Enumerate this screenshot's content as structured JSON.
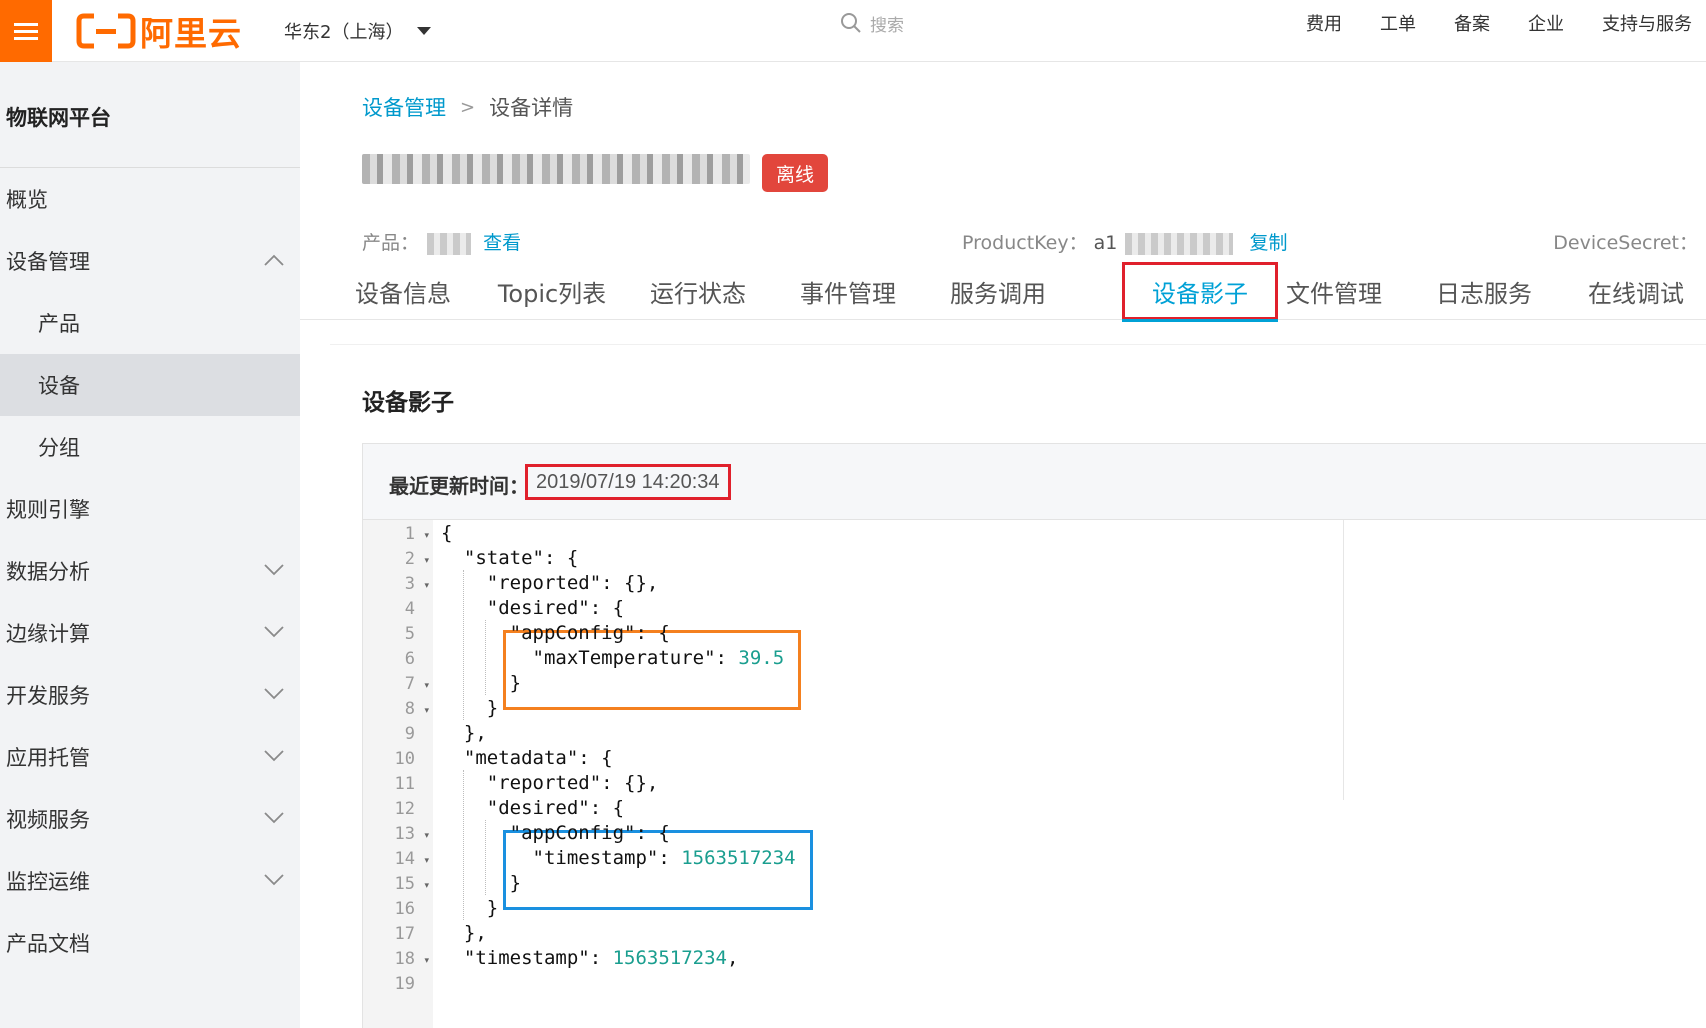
{
  "topbar": {
    "logo_text": "阿里云",
    "region": "华东2（上海）",
    "search_placeholder": "搜索",
    "links": [
      "费用",
      "工单",
      "备案",
      "企业",
      "支持与服务"
    ]
  },
  "sidebar": {
    "title": "物联网平台",
    "items": [
      {
        "label": "概览",
        "sub": false,
        "active": false,
        "chevron": "none"
      },
      {
        "label": "设备管理",
        "sub": false,
        "active": false,
        "chevron": "up"
      },
      {
        "label": "产品",
        "sub": true,
        "active": false,
        "chevron": "none"
      },
      {
        "label": "设备",
        "sub": true,
        "active": true,
        "chevron": "none"
      },
      {
        "label": "分组",
        "sub": true,
        "active": false,
        "chevron": "none"
      },
      {
        "label": "规则引擎",
        "sub": false,
        "active": false,
        "chevron": "none"
      },
      {
        "label": "数据分析",
        "sub": false,
        "active": false,
        "chevron": "down"
      },
      {
        "label": "边缘计算",
        "sub": false,
        "active": false,
        "chevron": "down"
      },
      {
        "label": "开发服务",
        "sub": false,
        "active": false,
        "chevron": "down"
      },
      {
        "label": "应用托管",
        "sub": false,
        "active": false,
        "chevron": "down"
      },
      {
        "label": "视频服务",
        "sub": false,
        "active": false,
        "chevron": "down"
      },
      {
        "label": "监控运维",
        "sub": false,
        "active": false,
        "chevron": "down"
      },
      {
        "label": "产品文档",
        "sub": false,
        "active": false,
        "chevron": "none"
      }
    ]
  },
  "breadcrumb": {
    "parent": "设备管理",
    "separator": ">",
    "current": "设备详情"
  },
  "device": {
    "status": "离线",
    "product_label": "产品：",
    "product_link": "查看",
    "productkey_label": "ProductKey：",
    "productkey_prefix": "a1",
    "copy_link": "复制",
    "devicesecret_label": "DeviceSecret："
  },
  "tabs": [
    {
      "label": "设备信息",
      "active": false
    },
    {
      "label": "Topic列表",
      "active": false
    },
    {
      "label": "运行状态",
      "active": false
    },
    {
      "label": "事件管理",
      "active": false
    },
    {
      "label": "服务调用",
      "active": false
    },
    {
      "label": "设备影子",
      "active": true
    },
    {
      "label": "文件管理",
      "active": false
    },
    {
      "label": "日志服务",
      "active": false
    },
    {
      "label": "在线调试",
      "active": false
    }
  ],
  "shadow": {
    "section_title": "设备影子",
    "update_label": "最近更新时间：",
    "update_time": "2019/07/19 14:20:34",
    "code_lines": [
      {
        "n": "1",
        "fold": true,
        "text": "{"
      },
      {
        "n": "2",
        "fold": true,
        "text": "  \"state\": {"
      },
      {
        "n": "3",
        "fold": true,
        "text": "    \"reported\": {},"
      },
      {
        "n": "4",
        "fold": false,
        "text": "    \"desired\": {"
      },
      {
        "n": "5",
        "fold": false,
        "text": "      \"appConfig\": {"
      },
      {
        "n": "6",
        "fold": false,
        "text": "        \"maxTemperature\": ",
        "num": "39.5"
      },
      {
        "n": "7",
        "fold": true,
        "text": "      }"
      },
      {
        "n": "8",
        "fold": true,
        "text": "    }"
      },
      {
        "n": "9",
        "fold": false,
        "text": "  },"
      },
      {
        "n": "10",
        "fold": false,
        "text": "  \"metadata\": {"
      },
      {
        "n": "11",
        "fold": false,
        "text": "    \"reported\": {},"
      },
      {
        "n": "12",
        "fold": false,
        "text": "    \"desired\": {"
      },
      {
        "n": "13",
        "fold": true,
        "text": "      \"appConfig\": {"
      },
      {
        "n": "14",
        "fold": true,
        "text": "        \"timestamp\": ",
        "num": "1563517234"
      },
      {
        "n": "15",
        "fold": true,
        "text": "      }"
      },
      {
        "n": "16",
        "fold": false,
        "text": "    }"
      },
      {
        "n": "17",
        "fold": false,
        "text": "  },"
      },
      {
        "n": "18",
        "fold": true,
        "text": "  \"timestamp\": ",
        "num": "1563517234",
        "suffix": ","
      },
      {
        "n": "19",
        "fold": false,
        "text": ""
      }
    ]
  },
  "colors": {
    "brand": "#ff6a00",
    "link": "#0099cc",
    "tab_active": "#00a1d6",
    "badge_offline": "#e2463c",
    "highlight_red": "#e0202c",
    "highlight_orange": "#f4801f",
    "highlight_blue": "#1a90e0",
    "json_number": "#1a9e8f"
  },
  "icons": {
    "menu": "hamburger-menu-icon",
    "region_caret": "caret-down-icon",
    "search": "search-icon",
    "expand": "chevron-down-icon",
    "collapse": "chevron-up-icon",
    "fold": "fold-arrow-icon"
  }
}
